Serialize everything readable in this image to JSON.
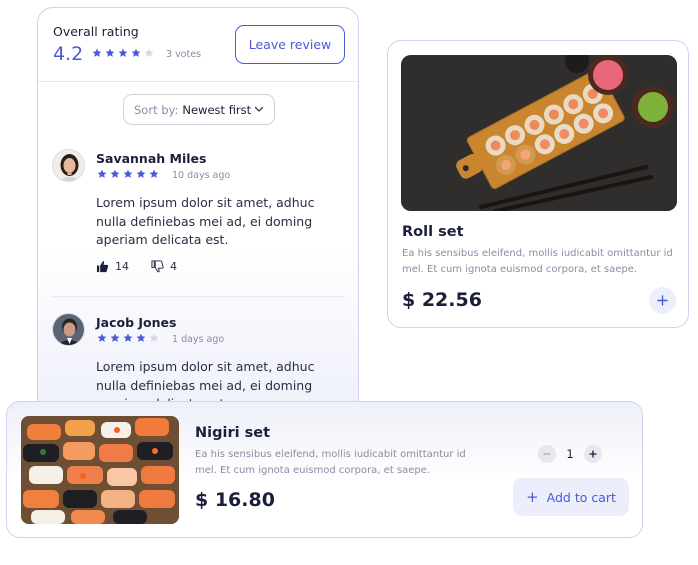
{
  "reviews": {
    "overall_label": "Overall rating",
    "score": "4.2",
    "score_stars": 4,
    "votes": "3 votes",
    "leave_review_label": "Leave review",
    "sort_label": "Sort by:",
    "sort_value": "Newest first",
    "items": [
      {
        "name": "Savannah Miles",
        "stars": 5,
        "time": "10 days ago",
        "text": "Lorem ipsum dolor sit amet, adhuc nulla definiebas mei ad, ei doming aperiam delicata est.",
        "likes": "14",
        "dislikes": "4"
      },
      {
        "name": "Jacob Jones",
        "stars": 4,
        "time": "1 days ago",
        "text": "Lorem ipsum dolor sit amet, adhuc nulla definiebas mei ad, ei doming aperiam delicata est."
      }
    ]
  },
  "roll": {
    "title": "Roll set",
    "description": "Ea his sensibus eleifend, mollis iudicabit omittantur id mel. Et cum ignota euismod corpora, et saepe.",
    "price": "$ 22.56"
  },
  "nigiri": {
    "title": "Nigiri set",
    "description": "Ea his sensibus eleifend, mollis iudicabit omittantur id mel. Et cum ignota euismod corpora, et saepe.",
    "price": "$ 16.80",
    "quantity": "1",
    "add_to_cart_label": "Add to cart"
  },
  "icons": {
    "star": "star-icon",
    "thumb_up": "thumbs-up-icon",
    "thumb_down": "thumbs-down-icon",
    "chevron": "chevron-down-icon",
    "plus": "plus-icon",
    "minus": "minus-icon"
  },
  "colors": {
    "accent": "#4b5ad8",
    "star_filled": "#4b5ad8",
    "star_empty": "#d6d7e0",
    "text": "#1c1f3a",
    "muted": "#8a8ca3"
  }
}
